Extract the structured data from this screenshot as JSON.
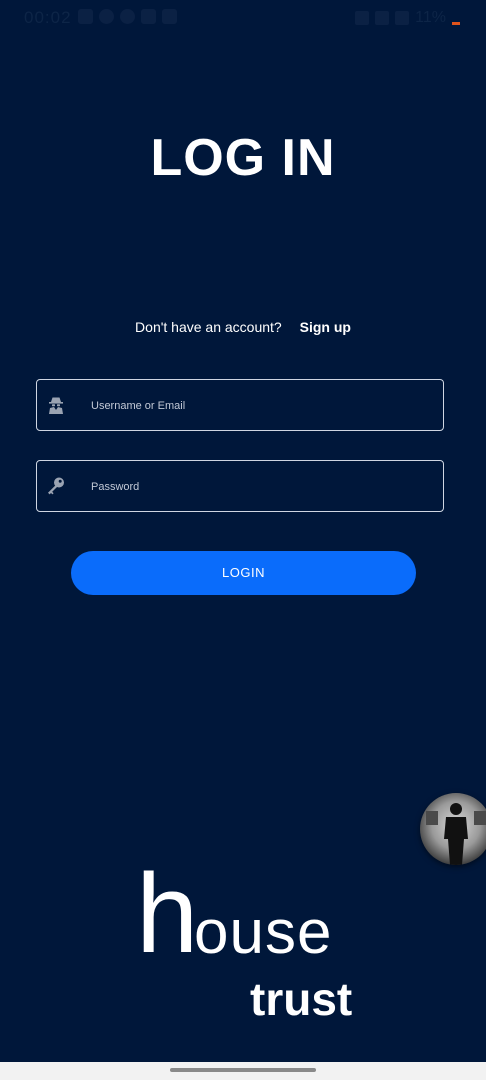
{
  "status_bar": {
    "time": "00:02",
    "battery": "11%"
  },
  "page": {
    "title": "LOG IN"
  },
  "signup": {
    "prompt": "Don't have an account?",
    "link_label": "Sign up"
  },
  "form": {
    "username_placeholder": "Username or Email",
    "username_value": "",
    "password_placeholder": "Password",
    "password_value": "",
    "submit_label": "LOGIN"
  },
  "brand": {
    "initial": "h",
    "rest": "ouse",
    "tagline": "trust"
  },
  "colors": {
    "background": "#00173a",
    "accent": "#0a6cfb",
    "text": "#ffffff"
  },
  "icons": {
    "username": "user-agent-icon",
    "password": "key-icon"
  }
}
